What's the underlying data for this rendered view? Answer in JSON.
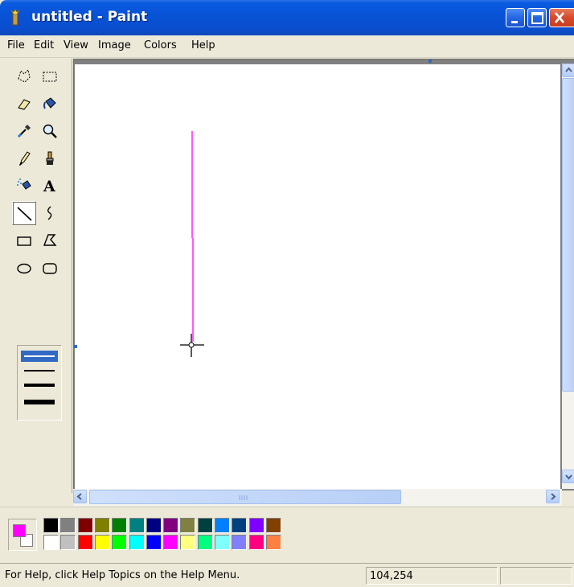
{
  "window": {
    "title": "untitled - Paint",
    "close_color": "#D8492C",
    "titlebar_color": "#0852D6"
  },
  "menu": {
    "items": [
      "File",
      "Edit",
      "View",
      "Image",
      "Colors",
      "Help"
    ]
  },
  "toolbox": {
    "tools": [
      {
        "icon": "free-form-select-icon"
      },
      {
        "icon": "select-icon"
      },
      {
        "icon": "eraser-icon"
      },
      {
        "icon": "fill-with-color-icon"
      },
      {
        "icon": "pick-color-icon"
      },
      {
        "icon": "magnifier-icon"
      },
      {
        "icon": "pencil-icon"
      },
      {
        "icon": "brush-icon"
      },
      {
        "icon": "airbrush-icon"
      },
      {
        "icon": "text-icon",
        "glyph": "A"
      },
      {
        "icon": "line-icon",
        "selected": true
      },
      {
        "icon": "curve-icon"
      },
      {
        "icon": "rectangle-icon"
      },
      {
        "icon": "polygon-icon"
      },
      {
        "icon": "ellipse-icon"
      },
      {
        "icon": "rounded-rectangle-icon"
      }
    ],
    "line_widths": [
      1,
      2,
      3,
      4
    ],
    "selected_width": 1
  },
  "canvas": {
    "background": "#FFFFFF",
    "stroke_color": "#FF00FF"
  },
  "palette": {
    "foreground": "#FF00FF",
    "background": "#FFFFFF",
    "top_row": [
      "#000000",
      "#808080",
      "#800000",
      "#808000",
      "#008000",
      "#008080",
      "#000080",
      "#800080",
      "#808040",
      "#004040",
      "#0080FF",
      "#004080",
      "#8000FF",
      "#804000"
    ],
    "bottom_row": [
      "#FFFFFF",
      "#C0C0C0",
      "#FF0000",
      "#FFFF00",
      "#00FF00",
      "#00FFFF",
      "#0000FF",
      "#FF00FF",
      "#FFFF80",
      "#00FF80",
      "#80FFFF",
      "#8080FF",
      "#FF0080",
      "#FF8040"
    ]
  },
  "statusbar": {
    "help_text": "For Help, click Help Topics on the Help Menu.",
    "coordinates": "104,254",
    "size": ""
  }
}
